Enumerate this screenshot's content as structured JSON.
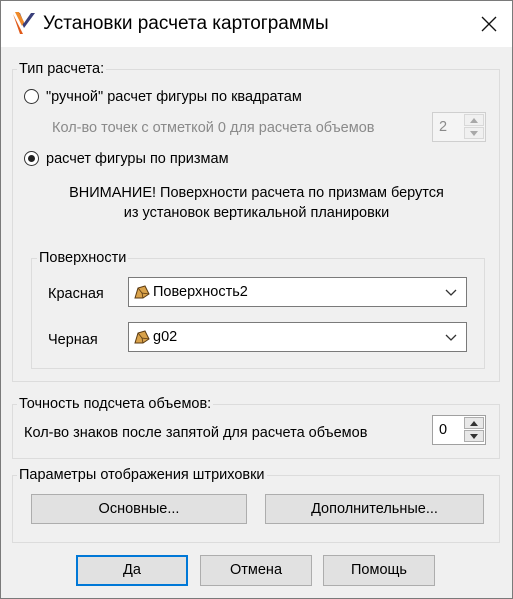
{
  "window": {
    "title": "Установки расчета картограммы",
    "icon": "app-logo-icon",
    "close_icon": "close-icon"
  },
  "calc_type": {
    "group_title": "Тип расчета:",
    "option_manual": {
      "label": "\"ручной\" расчет фигуры по квадратам",
      "selected": false
    },
    "points_label": "Кол-во точек с отметкой 0 для расчета объемов",
    "points_value": "2",
    "points_enabled": false,
    "option_prism": {
      "label": "расчет фигуры по призмам",
      "selected": true
    },
    "warning_line1": "ВНИМАНИЕ! Поверхности расчета по призмам берутся",
    "warning_line2": "из установок вертикальной планировки",
    "surfaces": {
      "group_title": "Поверхности",
      "red_label": "Красная",
      "red_value": "Поверхность2",
      "black_label": "Черная",
      "black_value": "g02",
      "surface_icon": "surface-icon",
      "dropdown_icon": "chevron-down-icon"
    }
  },
  "precision": {
    "group_title": "Точность подсчета объемов:",
    "decimals_label": "Кол-во знаков после запятой для расчета объемов",
    "decimals_value": "0"
  },
  "hatching": {
    "group_title": "Параметры отображения штриховки",
    "main_button": "Основные...",
    "extra_button": "Дополнительные..."
  },
  "footer": {
    "ok": "Да",
    "cancel": "Отмена",
    "help": "Помощь"
  },
  "colors": {
    "accent": "#0078d7",
    "background": "#f0f0f0",
    "disabled_text": "#8a8a8a"
  }
}
